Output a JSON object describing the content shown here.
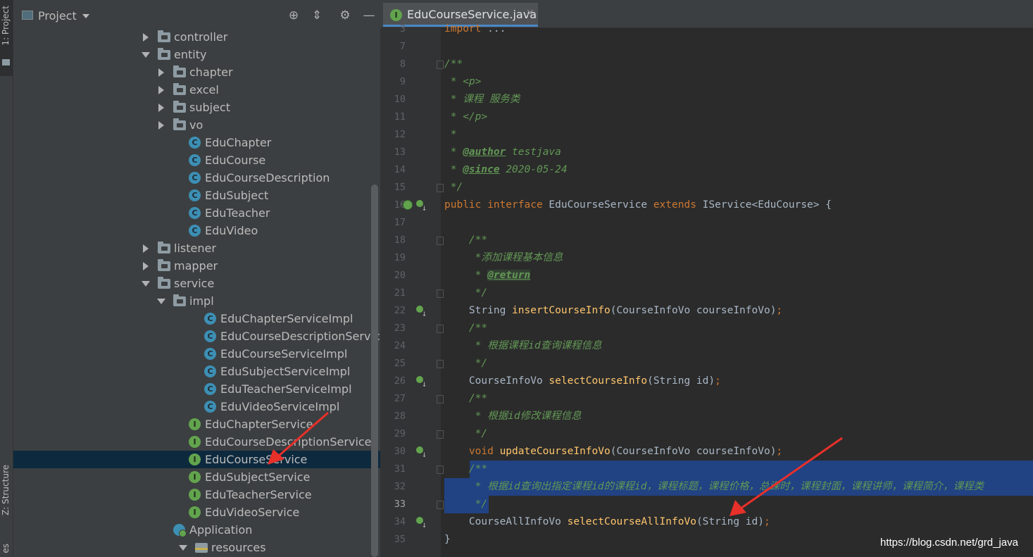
{
  "tool_strip": {
    "project_label": "1: Project",
    "structure_label": "Z: Structure",
    "favorites_label": "es"
  },
  "project_panel": {
    "title": "Project",
    "tree": [
      {
        "label": "controller",
        "kind": "folder",
        "indent": 1,
        "arrow": "right"
      },
      {
        "label": "entity",
        "kind": "folder",
        "indent": 1,
        "arrow": "down"
      },
      {
        "label": "chapter",
        "kind": "folder",
        "indent": 2,
        "arrow": "right"
      },
      {
        "label": "excel",
        "kind": "folder",
        "indent": 2,
        "arrow": "right"
      },
      {
        "label": "subject",
        "kind": "folder",
        "indent": 2,
        "arrow": "right"
      },
      {
        "label": "vo",
        "kind": "folder",
        "indent": 2,
        "arrow": "right"
      },
      {
        "label": "EduChapter",
        "kind": "class",
        "indent": 2
      },
      {
        "label": "EduCourse",
        "kind": "class",
        "indent": 2
      },
      {
        "label": "EduCourseDescription",
        "kind": "class",
        "indent": 2
      },
      {
        "label": "EduSubject",
        "kind": "class",
        "indent": 2
      },
      {
        "label": "EduTeacher",
        "kind": "class",
        "indent": 2
      },
      {
        "label": "EduVideo",
        "kind": "class",
        "indent": 2
      },
      {
        "label": "listener",
        "kind": "folder",
        "indent": 1,
        "arrow": "right"
      },
      {
        "label": "mapper",
        "kind": "folder",
        "indent": 1,
        "arrow": "right"
      },
      {
        "label": "service",
        "kind": "folder",
        "indent": 1,
        "arrow": "down"
      },
      {
        "label": "impl",
        "kind": "folder",
        "indent": 2,
        "arrow": "down"
      },
      {
        "label": "EduChapterServiceImpl",
        "kind": "class",
        "indent": 3
      },
      {
        "label": "EduCourseDescriptionServiceImpl",
        "kind": "class",
        "indent": 3
      },
      {
        "label": "EduCourseServiceImpl",
        "kind": "class",
        "indent": 3
      },
      {
        "label": "EduSubjectServiceImpl",
        "kind": "class",
        "indent": 3
      },
      {
        "label": "EduTeacherServiceImpl",
        "kind": "class",
        "indent": 3
      },
      {
        "label": "EduVideoServiceImpl",
        "kind": "class",
        "indent": 3
      },
      {
        "label": "EduChapterService",
        "kind": "interface",
        "indent": 2
      },
      {
        "label": "EduCourseDescriptionService",
        "kind": "interface",
        "indent": 2
      },
      {
        "label": "EduCourseService",
        "kind": "interface",
        "indent": 2,
        "selected": true
      },
      {
        "label": "EduSubjectService",
        "kind": "interface",
        "indent": 2
      },
      {
        "label": "EduTeacherService",
        "kind": "interface",
        "indent": 2
      },
      {
        "label": "EduVideoService",
        "kind": "interface",
        "indent": 2
      },
      {
        "label": "Application",
        "kind": "app",
        "indent": 1
      },
      {
        "label": "resources",
        "kind": "resfolder",
        "indent": 0,
        "arrow": "down"
      }
    ]
  },
  "editor": {
    "tab_label": "EduCourseService.java",
    "current_line": 33,
    "lines": [
      {
        "n": "3",
        "code": [
          {
            "t": "import",
            "c": "kw"
          },
          {
            "t": " ...",
            "c": ""
          }
        ]
      },
      {
        "n": "7",
        "code": []
      },
      {
        "n": "8",
        "code": [
          {
            "t": "/**",
            "c": "cm"
          }
        ]
      },
      {
        "n": "9",
        "code": [
          {
            "t": " * ",
            "c": "cm"
          },
          {
            "t": "<p>",
            "c": "tag"
          }
        ]
      },
      {
        "n": "10",
        "code": [
          {
            "t": " * 课程 服务类",
            "c": "cm"
          }
        ]
      },
      {
        "n": "11",
        "code": [
          {
            "t": " * ",
            "c": "cm"
          },
          {
            "t": "</p>",
            "c": "tag"
          }
        ]
      },
      {
        "n": "12",
        "code": [
          {
            "t": " *",
            "c": "cm"
          }
        ]
      },
      {
        "n": "13",
        "code": [
          {
            "t": " * ",
            "c": "cm"
          },
          {
            "t": "@author",
            "c": "ann"
          },
          {
            "t": " testjava",
            "c": "cm"
          }
        ]
      },
      {
        "n": "14",
        "code": [
          {
            "t": " * ",
            "c": "cm"
          },
          {
            "t": "@since",
            "c": "ann"
          },
          {
            "t": " 2020-05-24",
            "c": "cm"
          }
        ]
      },
      {
        "n": "15",
        "code": [
          {
            "t": " */",
            "c": "cm"
          }
        ]
      },
      {
        "n": "16",
        "code": [
          {
            "t": "public interface ",
            "c": "kw"
          },
          {
            "t": "EduCourseService ",
            "c": ""
          },
          {
            "t": "extends ",
            "c": "kw"
          },
          {
            "t": "IService<EduCourse> {",
            "c": ""
          }
        ]
      },
      {
        "n": "17",
        "code": []
      },
      {
        "n": "18",
        "code": [
          {
            "t": "    /**",
            "c": "cm"
          }
        ]
      },
      {
        "n": "19",
        "code": [
          {
            "t": "     *添加课程基本信息",
            "c": "cm"
          }
        ]
      },
      {
        "n": "20",
        "code": [
          {
            "t": "     * ",
            "c": "cm"
          },
          {
            "t": "@return",
            "c": "ann-hl"
          }
        ]
      },
      {
        "n": "21",
        "code": [
          {
            "t": "     */",
            "c": "cm"
          }
        ]
      },
      {
        "n": "22",
        "code": [
          {
            "t": "    String ",
            "c": ""
          },
          {
            "t": "insertCourseInfo",
            "c": "fn"
          },
          {
            "t": "(CourseInfoVo courseInfoVo)",
            "c": ""
          },
          {
            "t": ";",
            "c": "kw"
          }
        ]
      },
      {
        "n": "23",
        "code": [
          {
            "t": "    /**",
            "c": "cm"
          }
        ]
      },
      {
        "n": "24",
        "code": [
          {
            "t": "     * 根据课程id查询课程信息",
            "c": "cm"
          }
        ]
      },
      {
        "n": "25",
        "code": [
          {
            "t": "     */",
            "c": "cm"
          }
        ]
      },
      {
        "n": "26",
        "code": [
          {
            "t": "    CourseInfoVo ",
            "c": ""
          },
          {
            "t": "selectCourseInfo",
            "c": "fn"
          },
          {
            "t": "(String id)",
            "c": ""
          },
          {
            "t": ";",
            "c": "kw"
          }
        ]
      },
      {
        "n": "27",
        "code": [
          {
            "t": "    /**",
            "c": "cm"
          }
        ]
      },
      {
        "n": "28",
        "code": [
          {
            "t": "     * 根据id修改课程信息",
            "c": "cm"
          }
        ]
      },
      {
        "n": "29",
        "code": [
          {
            "t": "     */",
            "c": "cm"
          }
        ]
      },
      {
        "n": "30",
        "code": [
          {
            "t": "    void ",
            "c": "kw"
          },
          {
            "t": "updateCourseInfoVo",
            "c": "fn"
          },
          {
            "t": "(CourseInfoVo courseInfoVo)",
            "c": ""
          },
          {
            "t": ";",
            "c": "kw"
          }
        ]
      },
      {
        "n": "31",
        "code": [
          {
            "t": "    /**",
            "c": "cm"
          }
        ]
      },
      {
        "n": "32",
        "code": [
          {
            "t": "     * 根据id查询出指定课程id的课程id，课程标题，课程价格，总课时，课程封面，课程讲师，课程简介，课程类",
            "c": "cm"
          }
        ]
      },
      {
        "n": "33",
        "code": [
          {
            "t": "     */",
            "c": "cm"
          }
        ]
      },
      {
        "n": "34",
        "code": [
          {
            "t": "    CourseAllInfoVo ",
            "c": ""
          },
          {
            "t": "selectCourseAllInfoVo",
            "c": "fn"
          },
          {
            "t": "(String id)",
            "c": ""
          },
          {
            "t": ";",
            "c": "kw"
          }
        ]
      },
      {
        "n": "35",
        "code": [
          {
            "t": "}",
            "c": ""
          }
        ]
      }
    ]
  },
  "watermark": "https://blog.csdn.net/grd_java",
  "colors": {
    "selection": "#214283",
    "tree_selection": "#0d293e",
    "annotation_arrow": "#e8302a"
  }
}
